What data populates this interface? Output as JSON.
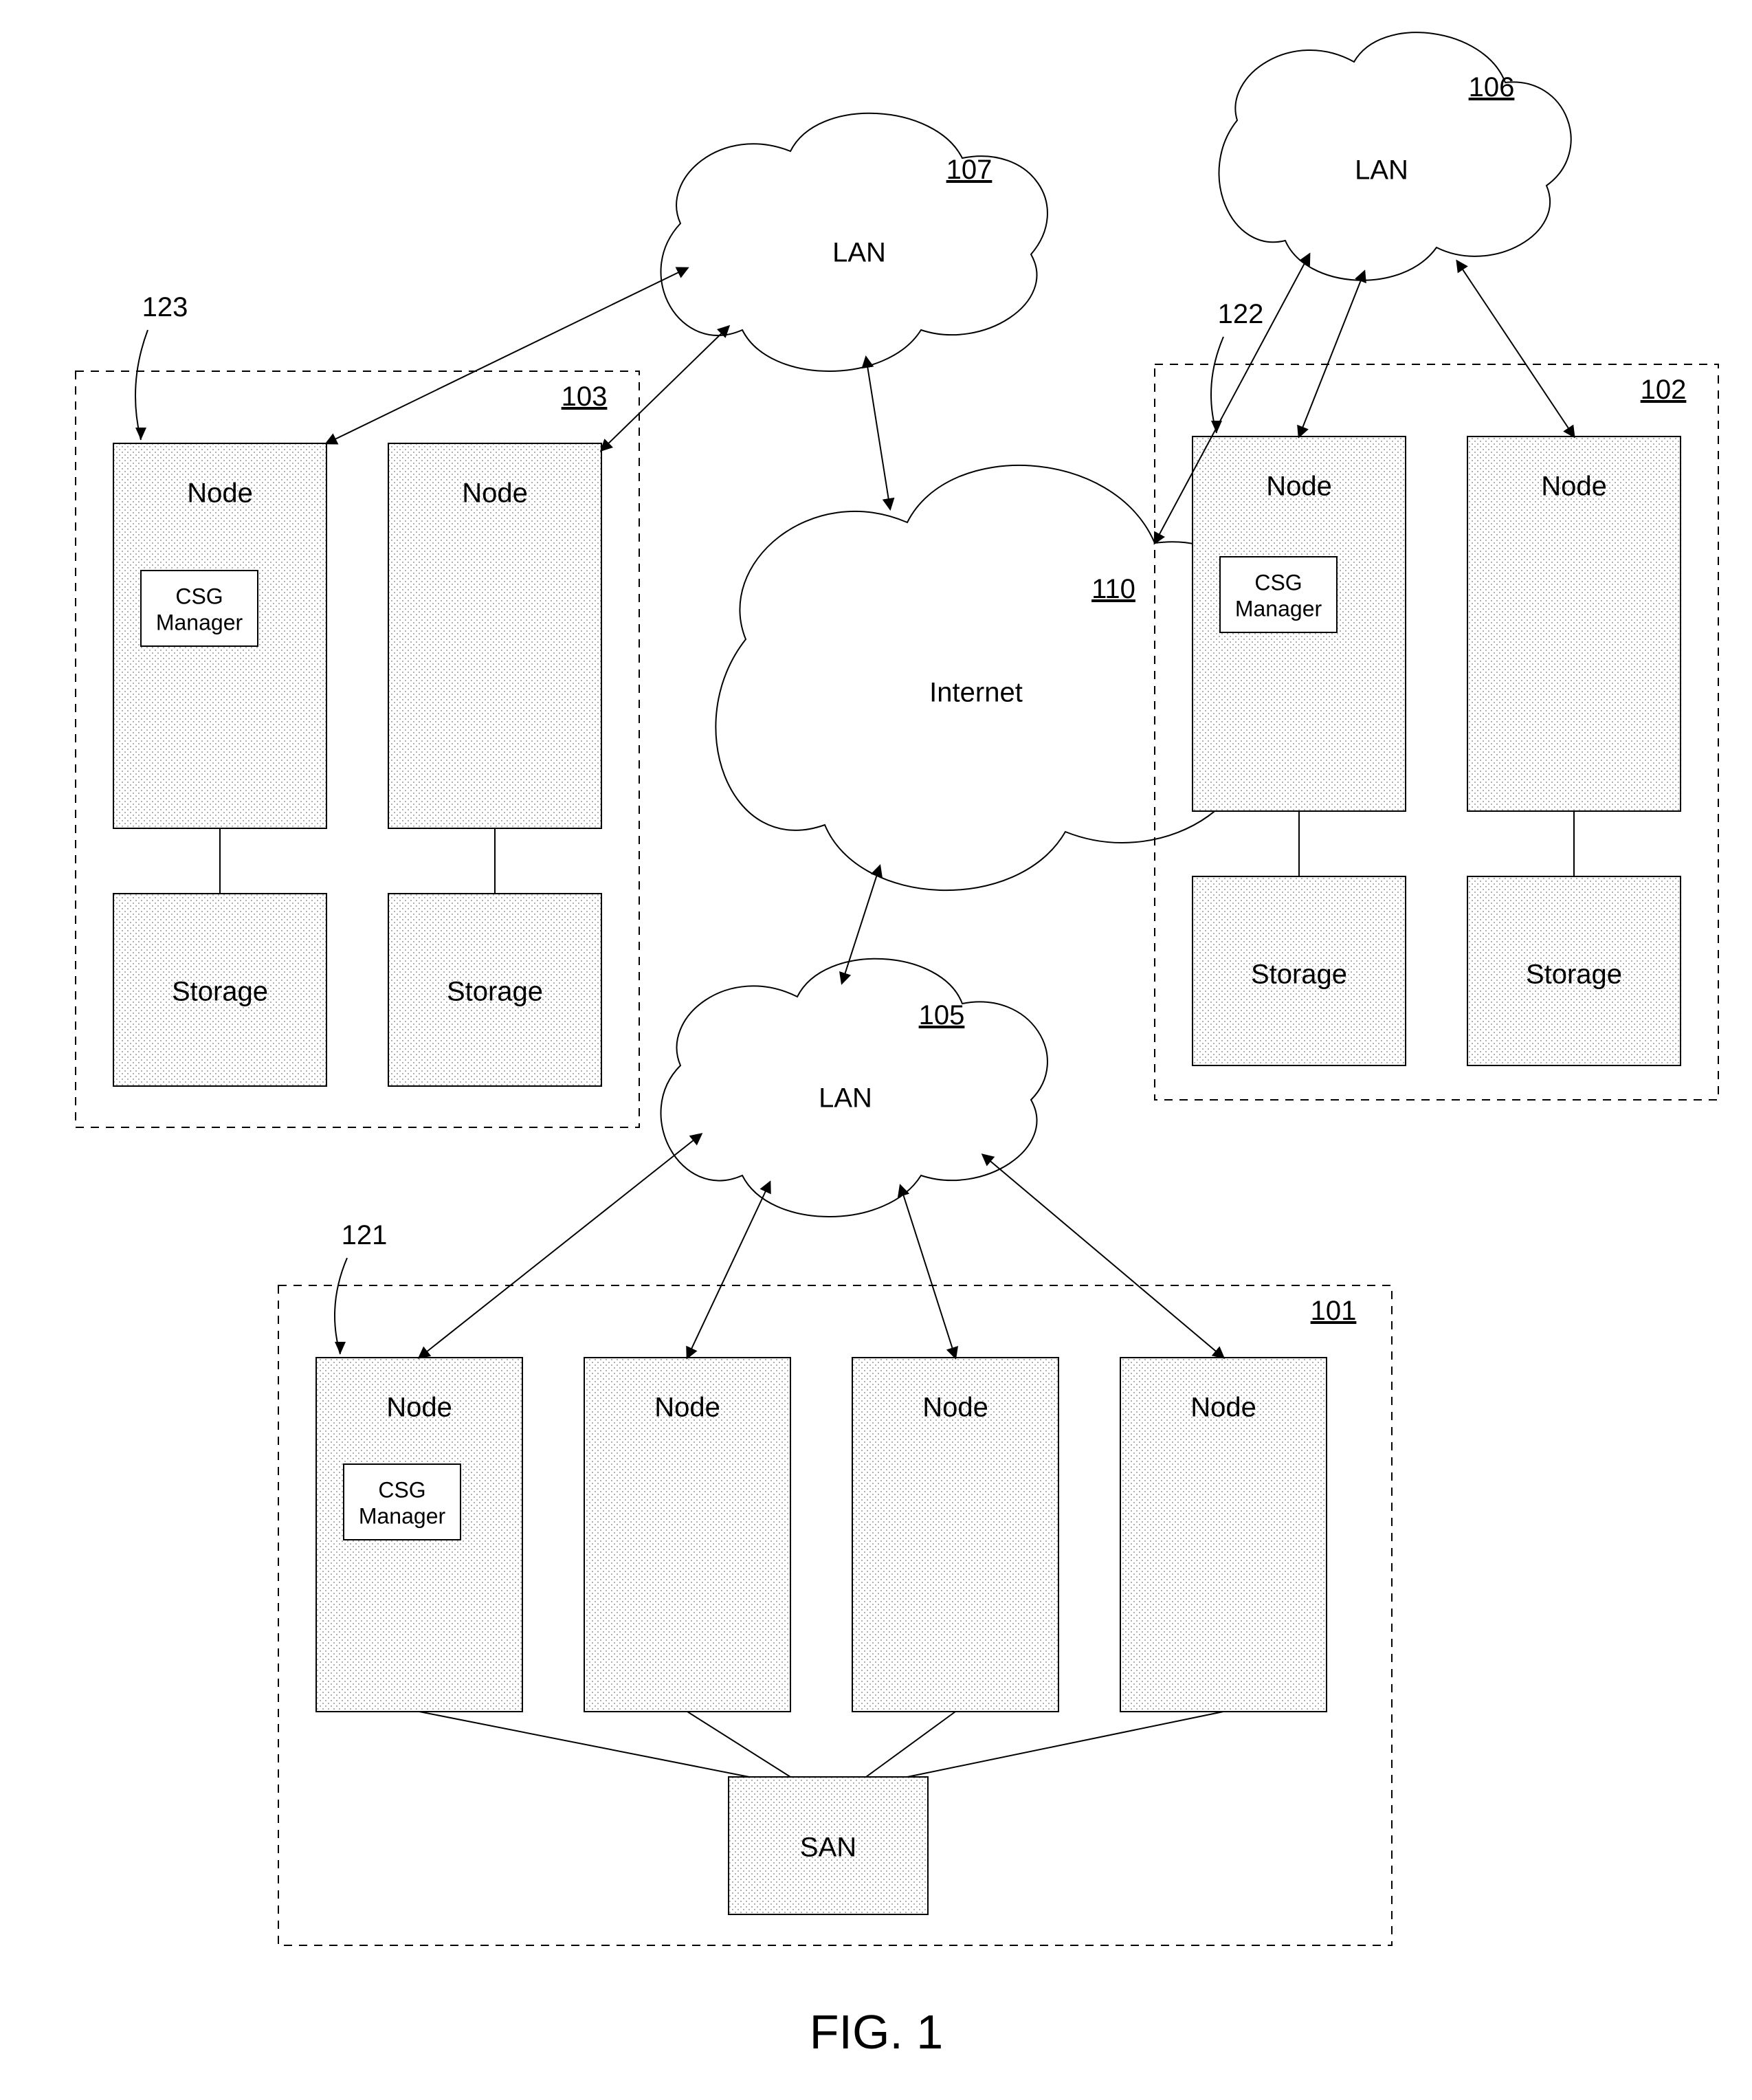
{
  "figure": {
    "caption": "FIG. 1"
  },
  "clouds": {
    "internet": {
      "label": "Internet",
      "ref": "110"
    },
    "lan105": {
      "label": "LAN",
      "ref": "105"
    },
    "lan106": {
      "label": "LAN",
      "ref": "106"
    },
    "lan107": {
      "label": "LAN",
      "ref": "107"
    }
  },
  "groups": {
    "g101": {
      "ref": "101",
      "callout": "121",
      "csg": "CSG\nManager",
      "nodes": [
        "Node",
        "Node",
        "Node",
        "Node"
      ],
      "san": "SAN"
    },
    "g102": {
      "ref": "102",
      "callout": "122",
      "csg": "CSG\nManager",
      "nodes": [
        "Node",
        "Node"
      ],
      "storage": [
        "Storage",
        "Storage"
      ]
    },
    "g103": {
      "ref": "103",
      "callout": "123",
      "csg": "CSG\nManager",
      "nodes": [
        "Node",
        "Node"
      ],
      "storage": [
        "Storage",
        "Storage"
      ]
    }
  }
}
